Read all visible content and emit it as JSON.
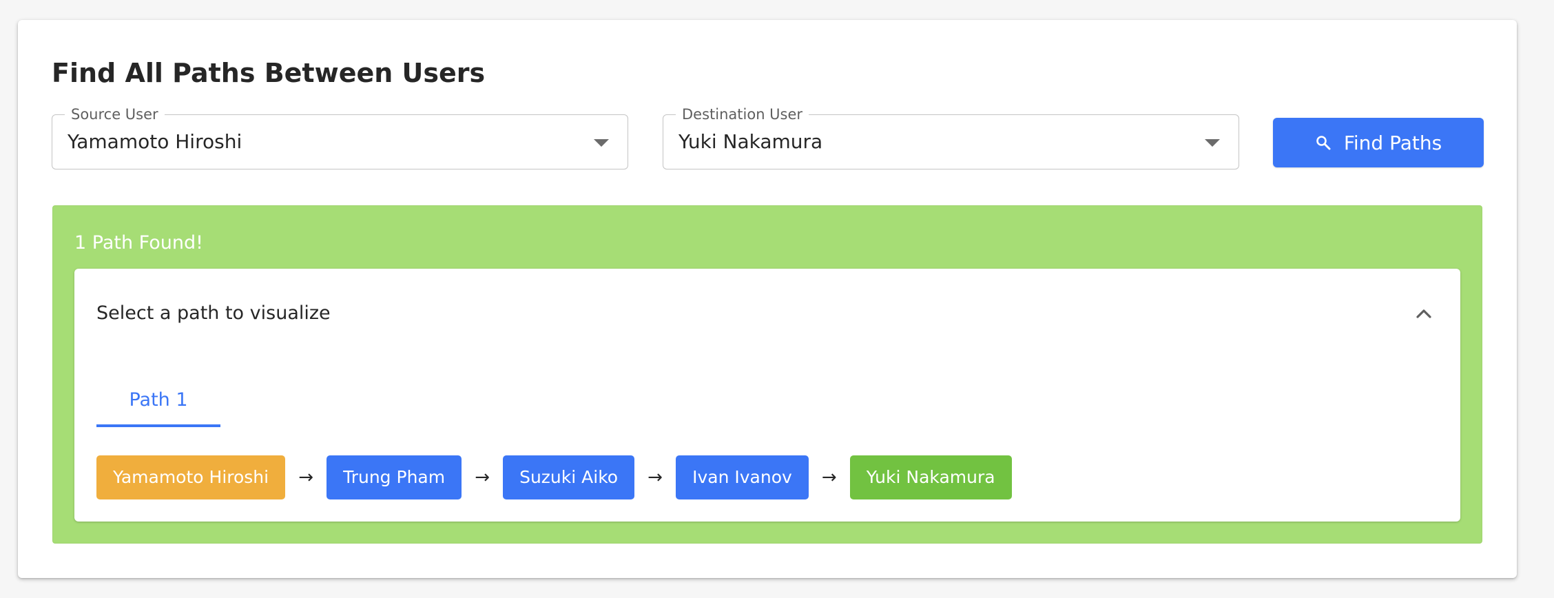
{
  "page": {
    "title": "Find All Paths Between Users"
  },
  "form": {
    "source": {
      "label": "Source User",
      "value": "Yamamoto Hiroshi"
    },
    "destination": {
      "label": "Destination User",
      "value": "Yuki Nakamura"
    },
    "find_button": {
      "label": "Find Paths",
      "icon": "search-icon"
    }
  },
  "results": {
    "title": "1 Path Found!",
    "panel_title": "Select a path to visualize",
    "collapse_icon": "chevron-up-icon",
    "tabs": [
      {
        "label": "Path 1"
      }
    ],
    "path": [
      {
        "name": "Yamamoto Hiroshi",
        "role": "source"
      },
      {
        "name": "Trung Pham",
        "role": "intermediate"
      },
      {
        "name": "Suzuki Aiko",
        "role": "intermediate"
      },
      {
        "name": "Ivan Ivanov",
        "role": "intermediate"
      },
      {
        "name": "Yuki Nakamura",
        "role": "destination"
      }
    ],
    "arrow_glyph": "→"
  },
  "colors": {
    "primary": "#3b76f6",
    "success_bg": "#a6dd75",
    "source_chip": "#f0ae3d",
    "intermediate_chip": "#3b76f6",
    "destination_chip": "#72c241"
  }
}
